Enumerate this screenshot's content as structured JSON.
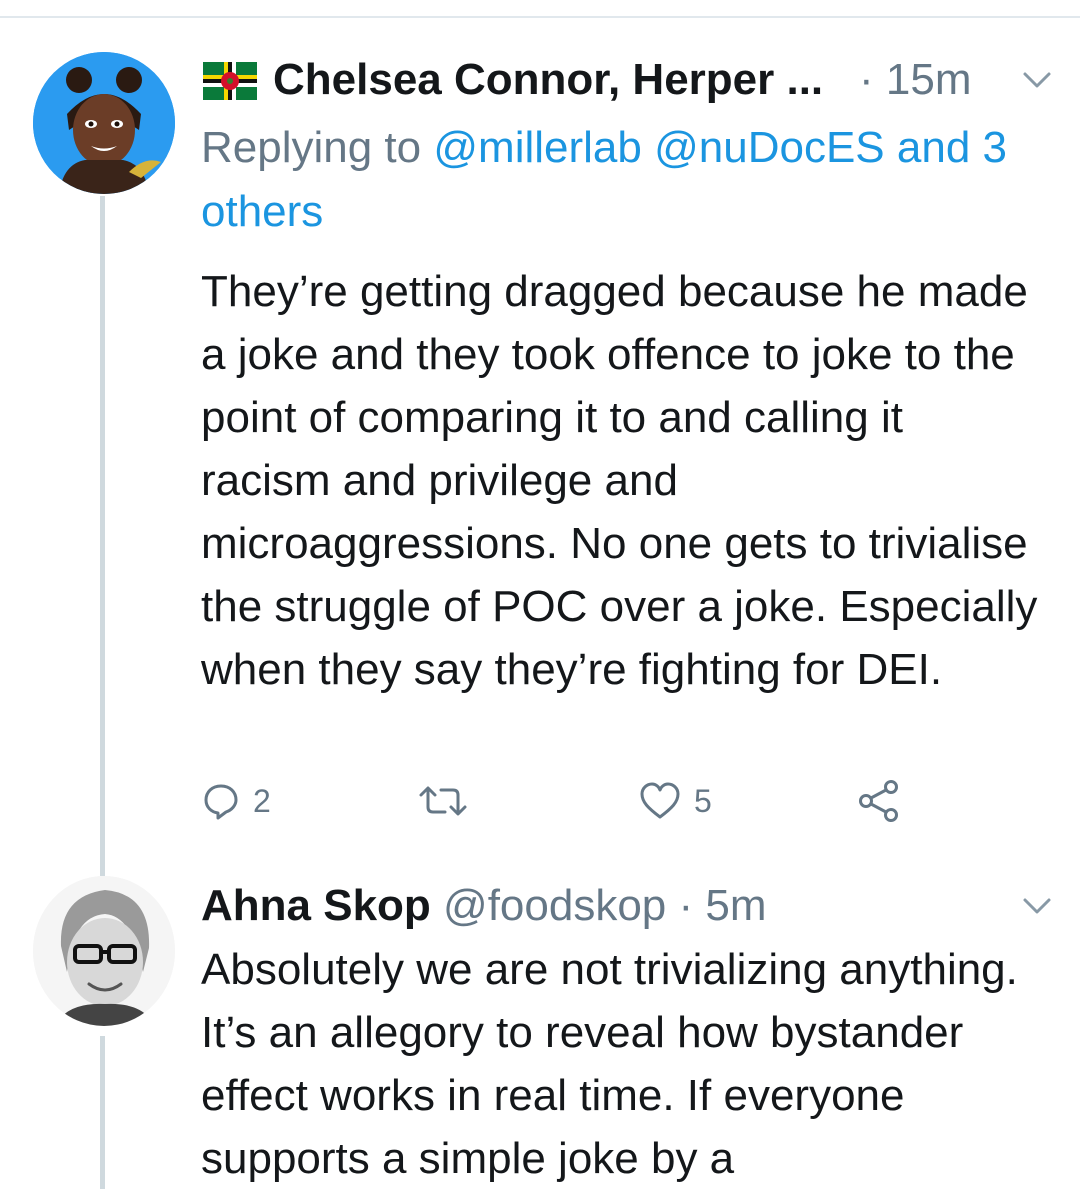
{
  "tweets": [
    {
      "display_name": "Chelsea Connor, Herper ...",
      "timestamp": "15m",
      "reply_prefix": "Replying to",
      "reply_mentions": "@millerlab @nuDocES",
      "reply_and": "and",
      "reply_others": "3 others",
      "body": "They’re getting dragged because he made a joke and they took offence to joke to the point of comparing it to and calling it racism and privilege and microaggressions. No one gets to trivialise the struggle of POC over a joke. Especially when they say they’re fighting for DEI.",
      "actions": {
        "reply_count": "2",
        "retweet_count": "",
        "like_count": "5"
      }
    },
    {
      "display_name": "Ahna Skop",
      "handle": "@foodskop",
      "timestamp": "5m",
      "body": "Absolutely we are not trivializing anything. It’s an allegory to reveal how bystander effect works in real time. If everyone supports a simple joke by a"
    }
  ],
  "icons": {
    "flag": "dominica-flag-icon",
    "caret": "chevron-down-icon",
    "reply": "reply-icon",
    "retweet": "retweet-icon",
    "like": "heart-icon",
    "share": "share-icon"
  },
  "colors": {
    "text": "#14171a",
    "secondary": "#657786",
    "link": "#1b95e0",
    "thread_line": "#cfd9de",
    "avatar_bg": "#2b9bf0"
  }
}
